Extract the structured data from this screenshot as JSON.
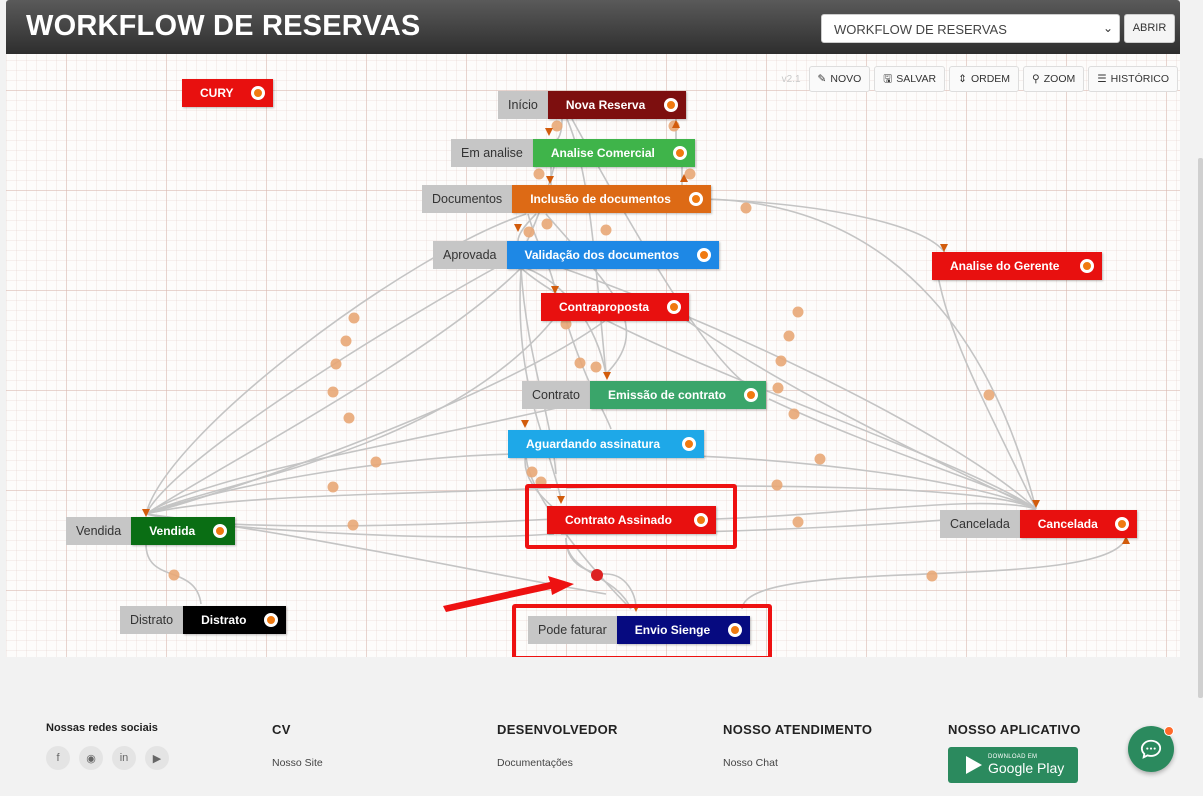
{
  "header": {
    "title": "WORKFLOW DE RESERVAS",
    "select_value": "WORKFLOW DE RESERVAS",
    "open_label": "ABRIR"
  },
  "toolbar": {
    "version": "v2.1",
    "novo": "NOVO",
    "salvar": "SALVAR",
    "ordem": "ORDEM",
    "zoom": "ZOOM",
    "historico": "HISTÓRICO"
  },
  "nodes": {
    "cury": {
      "name": "CURY",
      "color": "#e8100f"
    },
    "nova_reserva": {
      "label": "Início",
      "name": "Nova Reserva",
      "color": "#7d0f0f"
    },
    "analise_comercial": {
      "label": "Em analise",
      "name": "Analise Comercial",
      "color": "#3fb44a"
    },
    "inclusao_documentos": {
      "label": "Documentos",
      "name": "Inclusão de documentos",
      "color": "#dd6a15"
    },
    "validacao_documentos": {
      "label": "Aprovada",
      "name": "Validação dos documentos",
      "color": "#1e88e5"
    },
    "analise_gerente": {
      "name": "Analise do Gerente",
      "color": "#e8100f"
    },
    "contraproposta": {
      "name": "Contraproposta",
      "color": "#e8100f"
    },
    "emissao_contrato": {
      "label": "Contrato",
      "name": "Emissão de contrato",
      "color": "#3aa56a"
    },
    "aguardando_assinatura": {
      "name": "Aguardando assinatura",
      "color": "#1ea8e8"
    },
    "contrato_assinado": {
      "name": "Contrato Assinado",
      "color": "#e8100f"
    },
    "vendida": {
      "label": "Vendida",
      "name": "Vendida",
      "color": "#0a6e14"
    },
    "cancelada": {
      "label": "Cancelada",
      "name": "Cancelada",
      "color": "#e8100f"
    },
    "distrato": {
      "label": "Distrato",
      "name": "Distrato",
      "color": "#000000"
    },
    "envio_sienge": {
      "label": "Pode faturar",
      "name": "Envio Sienge",
      "color": "#060a80"
    }
  },
  "footer": {
    "social_title": "Nossas redes sociais",
    "social_icons": [
      "facebook-icon",
      "instagram-icon",
      "linkedin-icon",
      "youtube-icon"
    ],
    "cv": {
      "title": "CV",
      "link1": "Nosso Site"
    },
    "dev": {
      "title": "DESENVOLVEDOR",
      "link1": "Documentações"
    },
    "atendimento": {
      "title": "NOSSO ATENDIMENTO",
      "link1": "Nosso Chat"
    },
    "app": {
      "title": "NOSSO APLICATIVO",
      "gplay_small": "DOWNLOAD EM",
      "gplay_big": "Google Play"
    }
  }
}
